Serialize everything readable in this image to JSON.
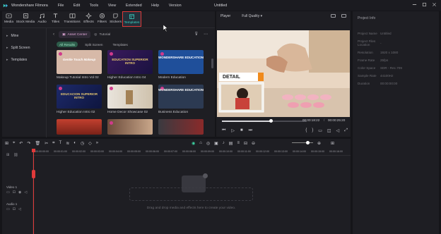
{
  "titlebar": {
    "app_name": "Wondershare Filmora",
    "menus": [
      "File",
      "Edit",
      "Tools",
      "View",
      "Extended",
      "Help",
      "Version"
    ],
    "project": "Untitled"
  },
  "toolbar": {
    "tabs": [
      {
        "label": "Media",
        "icon": "media-icon"
      },
      {
        "label": "Stock Media",
        "icon": "stock-media-icon"
      },
      {
        "label": "Audio",
        "icon": "audio-icon"
      },
      {
        "label": "Titles",
        "icon": "titles-icon"
      },
      {
        "label": "Transitions",
        "icon": "transitions-icon"
      },
      {
        "label": "Effects",
        "icon": "effects-icon"
      },
      {
        "label": "Filters",
        "icon": "filters-icon"
      },
      {
        "label": "Stickers",
        "icon": "stickers-icon"
      },
      {
        "label": "Templates",
        "icon": "templates-icon"
      }
    ],
    "active_tab": "Templates",
    "accent_color": "#3cd4c3"
  },
  "library": {
    "sidebar": [
      "Mine",
      "Split Screen",
      "Templates"
    ],
    "search_chips": {
      "asset_center": "Asset Center",
      "tutorial": "Tutorial"
    },
    "filters": [
      "All Results",
      "Split Screen",
      "Templates"
    ],
    "cards": [
      {
        "title": "Makeup Tutorial Intro Vol 02",
        "thumb_text": "Gentle Touch Makeup"
      },
      {
        "title": "Higher Education Intro 04",
        "thumb_text": "EDUCATION SUPERIOR INTRO"
      },
      {
        "title": "Modern Education",
        "thumb_text": "WONDERSHARE EDUCATION"
      },
      {
        "title": "Higher Education Intro 02",
        "thumb_text": "EDUCACION SUPERIOR INTRO"
      },
      {
        "title": "Home Decor Showcase 02",
        "thumb_text": ""
      },
      {
        "title": "Business Education",
        "thumb_text": "WONDERSHARE EDUCATION"
      },
      {
        "title": "",
        "thumb_text": ""
      },
      {
        "title": "",
        "thumb_text": ""
      },
      {
        "title": "",
        "thumb_text": ""
      }
    ]
  },
  "player": {
    "label": "Player",
    "quality": "Full Quality",
    "overlay_text": "DETAIL",
    "current_time": "00:00:18:22",
    "total_time": "00:00:25:20",
    "progress_pct": 58
  },
  "project_info": {
    "title": "Project Info",
    "rows": [
      {
        "k": "Project Name",
        "v": "Untitled"
      },
      {
        "k": "Project Files Location",
        "v": "-"
      },
      {
        "k": "Resolution",
        "v": "1920 x 1080"
      },
      {
        "k": "Frame Rate",
        "v": "25fps"
      },
      {
        "k": "Color Space",
        "v": "SDR - Rec.709"
      },
      {
        "k": "Sample Rate",
        "v": "44100Hz"
      },
      {
        "k": "Duration",
        "v": "00:00:00:00"
      }
    ]
  },
  "timeline": {
    "ruler": [
      "00:00:00:00",
      "00:00:01:00",
      "00:00:02:00",
      "00:00:03:00",
      "00:00:04:00",
      "00:00:05:00",
      "00:00:06:00",
      "00:00:07:00",
      "00:00:08:00",
      "00:00:09:00",
      "00:00:10:00",
      "00:00:11:00",
      "00:00:12:00",
      "00:00:13:00",
      "00:00:14:00",
      "00:00:15:00",
      "00:00:16:00"
    ],
    "video_track": "Video 1",
    "audio_track": "Audio 1",
    "drop_hint": "Drag and drop media and effects here to create your video."
  }
}
